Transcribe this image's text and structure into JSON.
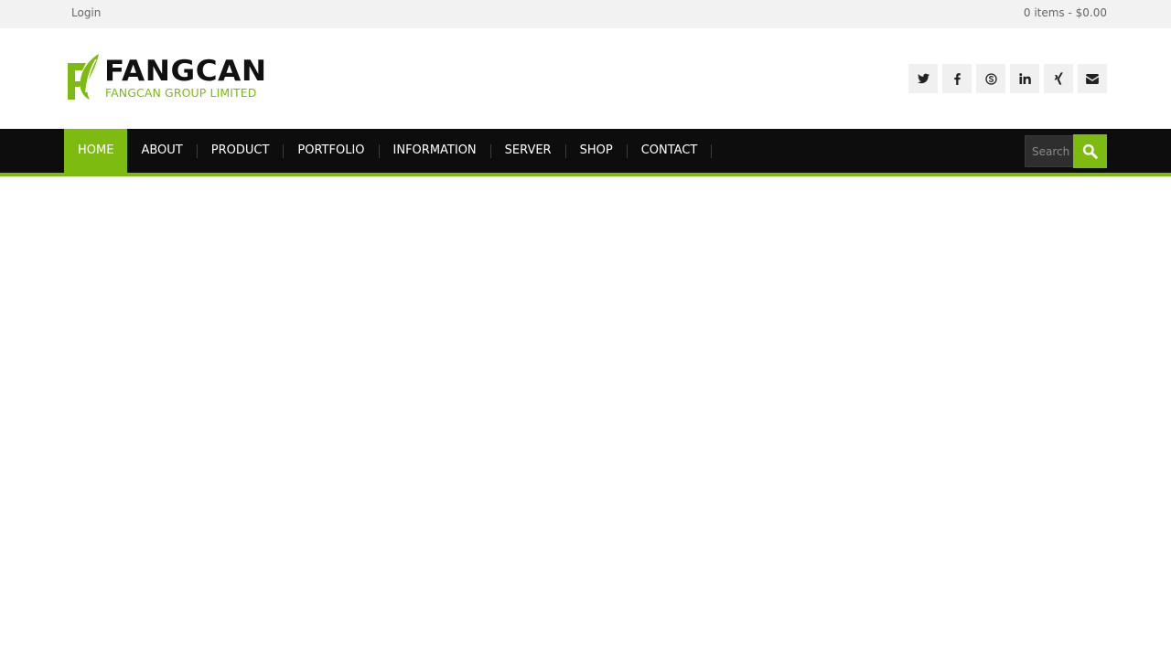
{
  "topbar": {
    "login_label": "Login",
    "cart_label": "0 items - $0.00"
  },
  "logo": {
    "brand": "FANGCAN",
    "tagline": "FANGCAN GROUP LIMITED"
  },
  "social": [
    {
      "name": "twitter-icon"
    },
    {
      "name": "facebook-icon"
    },
    {
      "name": "skype-icon"
    },
    {
      "name": "linkedin-icon"
    },
    {
      "name": "xing-icon"
    },
    {
      "name": "email-icon"
    }
  ],
  "nav": {
    "items": [
      {
        "label": "HOME",
        "active": true
      },
      {
        "label": "ABOUT"
      },
      {
        "label": "PRODUCT"
      },
      {
        "label": "PORTFOLIO"
      },
      {
        "label": "INFORMATION"
      },
      {
        "label": "SERVER"
      },
      {
        "label": "SHOP"
      },
      {
        "label": "CONTACT"
      }
    ]
  },
  "search": {
    "placeholder": "Search"
  },
  "colors": {
    "accent": "#7dbb11",
    "nav_bg": "#0d0d0d",
    "topbar_bg": "#f2f2f2"
  }
}
